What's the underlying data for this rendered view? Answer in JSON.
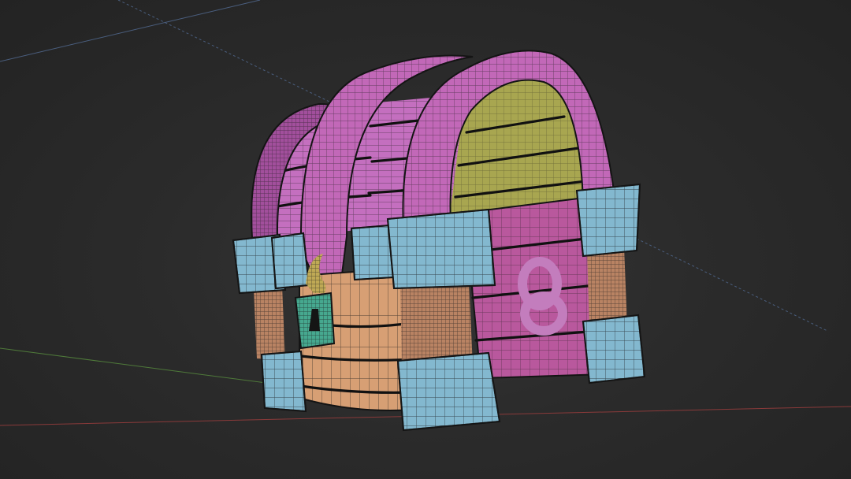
{
  "viewport": {
    "mode": "wireframe-overlay"
  },
  "scene": {
    "object": "treasure-chest",
    "colors": {
      "background": "#2b2b2b",
      "lid_band": "#c268b8",
      "lid_band_dark": "#a24f9c",
      "lid_plank": "#c46fbf",
      "lid_inner": "#a8a650",
      "front_panel": "#d79f74",
      "side_panel": "#b9589d",
      "corner_bracket": "#83b8cf",
      "leg_wood": "#b98363",
      "lock": "#46a88f",
      "hinge": "#bfa955",
      "ring_handle": "#c37dbd",
      "axis_x": "#8a3a3a",
      "axis_y": "#4f7a3a",
      "guide_line": "#4a5e7e"
    }
  }
}
